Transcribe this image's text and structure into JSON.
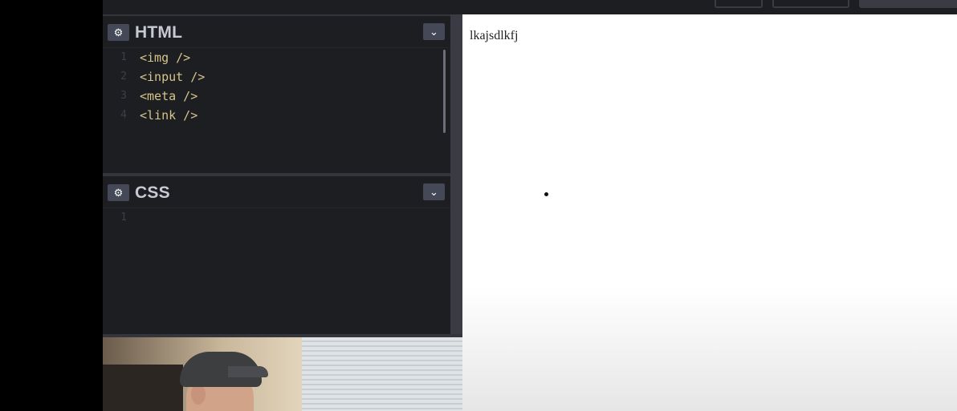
{
  "html_panel": {
    "title": "HTML",
    "settings_icon": "gear-icon",
    "collapse_icon": "chevron-down-icon",
    "lines": [
      {
        "num": "1",
        "code": "<img />"
      },
      {
        "num": "2",
        "code": "<input />"
      },
      {
        "num": "3",
        "code": "<meta />"
      },
      {
        "num": "4",
        "code": "<link />"
      }
    ]
  },
  "css_panel": {
    "title": "CSS",
    "settings_icon": "gear-icon",
    "collapse_icon": "chevron-down-icon",
    "lines": [
      {
        "num": "1",
        "code": ""
      }
    ]
  },
  "preview": {
    "text": "lkajsdlkfj"
  },
  "colors": {
    "editor_bg": "#1d1e22",
    "panel_button_bg": "#444857",
    "code_tag": "#d6c48a",
    "line_number": "#3d3f48",
    "preview_bg": "#ffffff"
  }
}
